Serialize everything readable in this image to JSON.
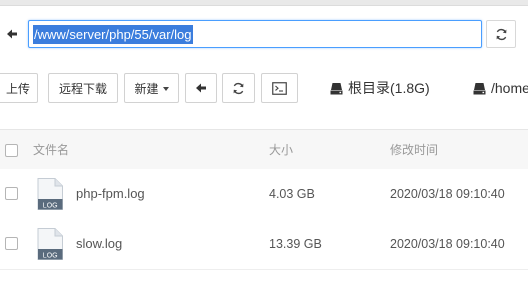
{
  "address": {
    "path": "/www/server/php/55/var/log"
  },
  "toolbar": {
    "upload_label": "上传",
    "remote_download_label": "远程下载",
    "new_label": "新建"
  },
  "disks": [
    {
      "label": "根目录(1.8G)"
    },
    {
      "label": "/home"
    }
  ],
  "table": {
    "headers": {
      "name": "文件名",
      "size": "大小",
      "modified": "修改时间"
    },
    "rows": [
      {
        "name": "php-fpm.log",
        "icon_text": "LOG",
        "size": "4.03 GB",
        "modified": "2020/03/18 09:10:40"
      },
      {
        "name": "slow.log",
        "icon_text": "LOG",
        "size": "13.39 GB",
        "modified": "2020/03/18 09:10:40"
      }
    ]
  },
  "colors": {
    "accent": "#4a9eff",
    "selection": "#3b7ddd",
    "header_bg": "#f7f7f7",
    "icon_label_bg": "#5a6b7d"
  }
}
